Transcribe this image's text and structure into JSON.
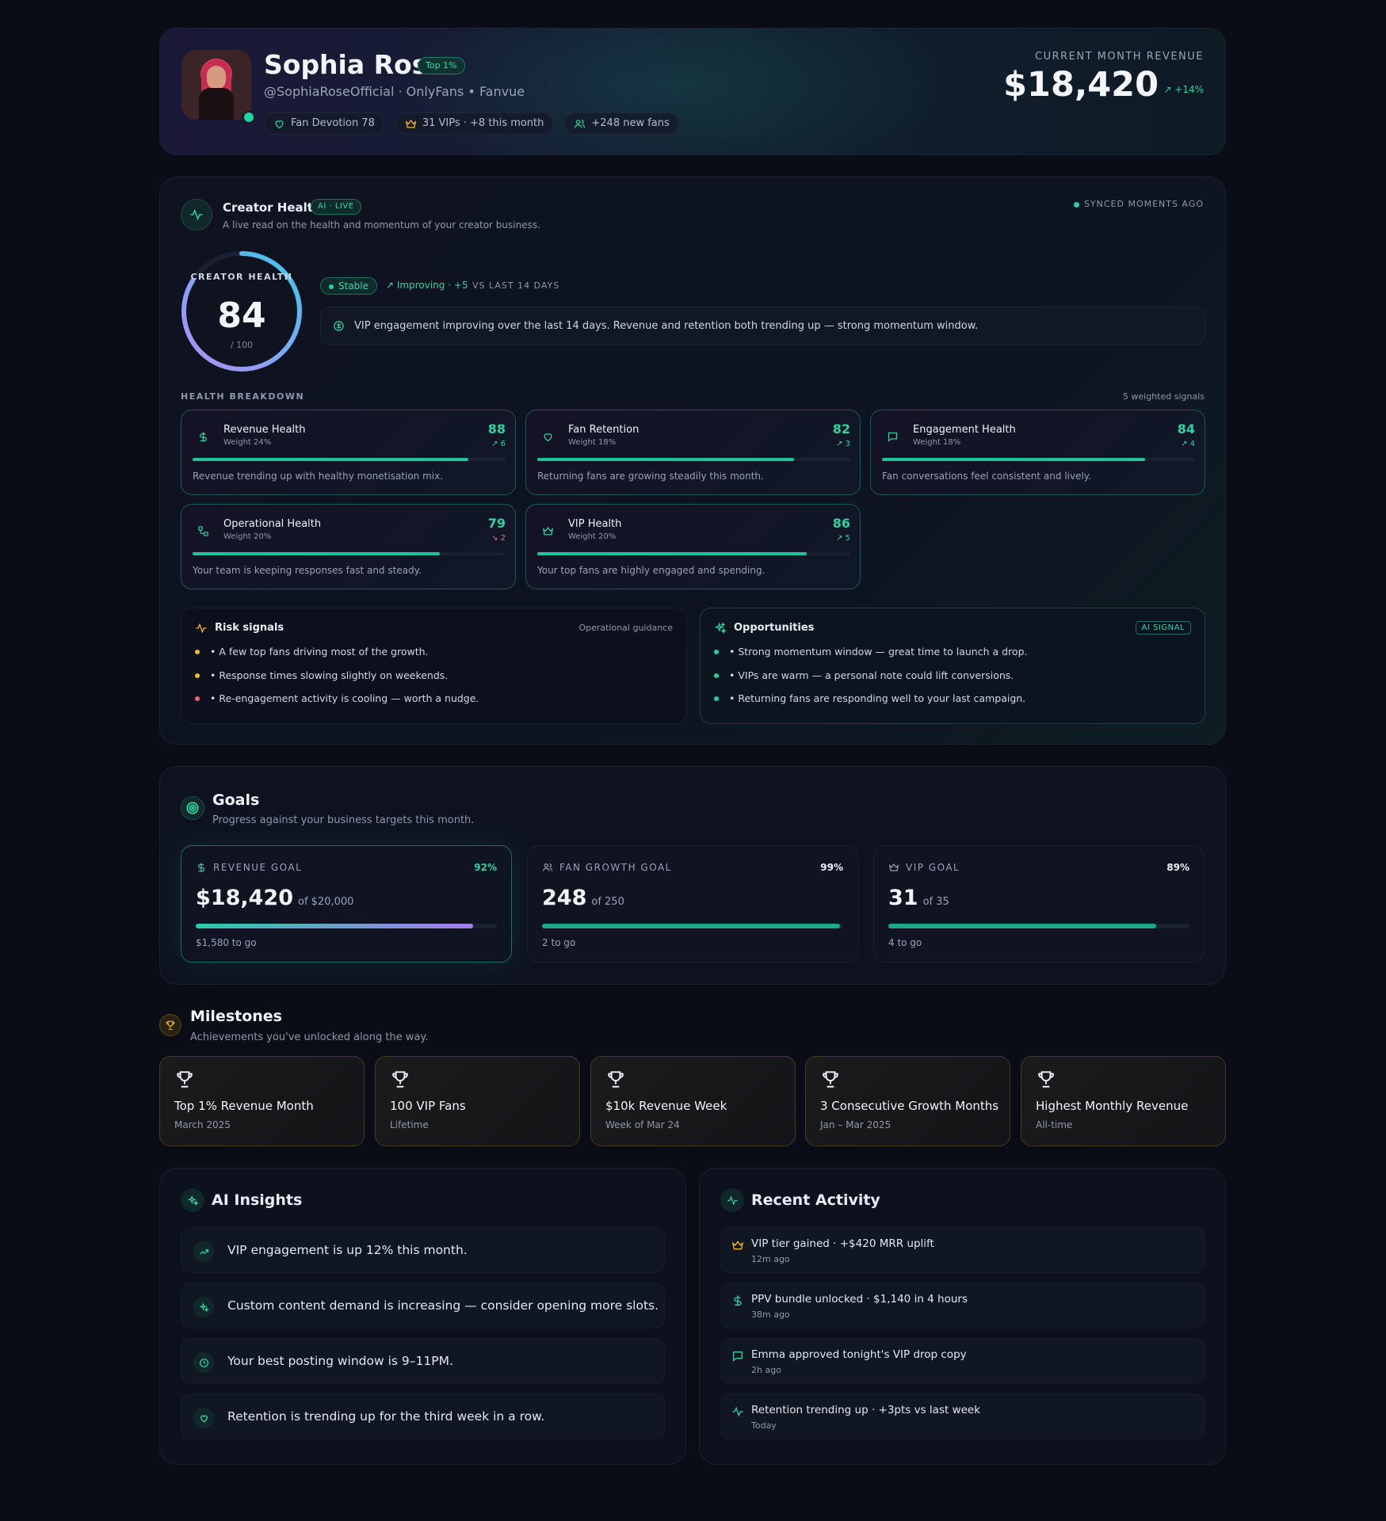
{
  "profile": {
    "name": "Sophia Rose",
    "badge": "Top 1%",
    "handle": "@SophiaRoseOfficial · OnlyFans • Fanvue",
    "chips": [
      {
        "icon": "heart-icon",
        "label": "Fan Devotion 78"
      },
      {
        "icon": "crown-icon",
        "label": "31 VIPs · +8 this month"
      },
      {
        "icon": "users-icon",
        "label": "+248 new fans"
      }
    ],
    "revenue_label": "CURRENT MONTH REVENUE",
    "revenue_value": "$18,420",
    "revenue_delta": "↗ +14%"
  },
  "health": {
    "title": "Creator Health",
    "ai_badge": "AI · LIVE",
    "subtitle": "A live read on the health and momentum of your creator business.",
    "synced": "SYNCED MOMENTS AGO",
    "gauge_label": "CREATOR HEALTH",
    "score": "84",
    "score_max": "/ 100",
    "score_fraction": 0.84,
    "status": "Stable",
    "trend": "↗ Improving · +5",
    "trend_period": "VS LAST 14 DAYS",
    "insight": "VIP engagement improving over the last 14 days. Revenue and retention both trending up — strong momentum window.",
    "breakdown_label": "HEALTH BREAKDOWN",
    "breakdown_count": "5 weighted signals",
    "cards": [
      {
        "icon": "dollar-icon",
        "title": "Revenue Health",
        "weight": "Weight 24%",
        "score": "88",
        "delta": "↗ 6",
        "fill": 0.88,
        "desc": "Revenue trending up with healthy monetisation mix."
      },
      {
        "icon": "heart-icon",
        "title": "Fan Retention",
        "weight": "Weight 18%",
        "score": "82",
        "delta": "↗ 3",
        "fill": 0.82,
        "desc": "Returning fans are growing steadily this month."
      },
      {
        "icon": "chat-icon",
        "title": "Engagement Health",
        "weight": "Weight 18%",
        "score": "84",
        "delta": "↗ 4",
        "fill": 0.84,
        "desc": "Fan conversations feel consistent and lively."
      },
      {
        "icon": "workflow-icon",
        "title": "Operational Health",
        "weight": "Weight 20%",
        "score": "79",
        "delta": "↘ 2",
        "fill": 0.79,
        "desc": "Your team is keeping responses fast and steady."
      },
      {
        "icon": "crown-icon",
        "title": "VIP Health",
        "weight": "Weight 20%",
        "score": "86",
        "delta": "↗ 5",
        "fill": 0.86,
        "desc": "Your top fans are highly engaged and spending."
      }
    ],
    "risk": {
      "title": "Risk signals",
      "right": "Operational guidance",
      "items": [
        {
          "text": "• A few top fans driving most of the growth.",
          "color": "#f5b82e"
        },
        {
          "text": "• Response times slowing slightly on weekends.",
          "color": "#f5b82e"
        },
        {
          "text": "• Re-engagement activity is cooling — worth a nudge.",
          "color": "#f0607a"
        }
      ]
    },
    "opps": {
      "title": "Opportunities",
      "badge": "AI SIGNAL",
      "items": [
        {
          "text": "• Strong momentum window — great time to launch a drop.",
          "color": "#22d3a0"
        },
        {
          "text": "• VIPs are warm — a personal note could lift conversions.",
          "color": "#22d3a0"
        },
        {
          "text": "• Returning fans are responding well to your last campaign.",
          "color": "#22d3a0"
        }
      ]
    }
  },
  "goals": {
    "title": "Goals",
    "subtitle": "Progress against your business targets this month.",
    "items": [
      {
        "icon": "dollar-icon",
        "label": "REVENUE GOAL",
        "pct": "92%",
        "value": "$18,420",
        "of": "of $20,000",
        "togo": "$1,580 to go",
        "fill": 0.92
      },
      {
        "icon": "users-icon",
        "label": "FAN GROWTH GOAL",
        "pct": "99%",
        "value": "248",
        "of": "of 250",
        "togo": "2 to go",
        "fill": 0.99
      },
      {
        "icon": "crown-icon",
        "label": "VIP GOAL",
        "pct": "89%",
        "value": "31",
        "of": "of 35",
        "togo": "4 to go",
        "fill": 0.89
      }
    ]
  },
  "milestones": {
    "title": "Milestones",
    "subtitle": "Achievements you've unlocked along the way.",
    "items": [
      {
        "title": "Top 1% Revenue Month",
        "sub": "March 2025"
      },
      {
        "title": "100 VIP Fans",
        "sub": "Lifetime"
      },
      {
        "title": "$10k Revenue Week",
        "sub": "Week of Mar 24"
      },
      {
        "title": "3 Consecutive Growth Months",
        "sub": "Jan – Mar 2025"
      },
      {
        "title": "Highest Monthly Revenue",
        "sub": "All-time"
      }
    ]
  },
  "insights": {
    "title": "AI Insights",
    "items": [
      {
        "icon": "trend-up-icon",
        "text": "VIP engagement is up 12% this month."
      },
      {
        "icon": "sparkle-icon",
        "text": "Custom content demand is increasing — consider opening more slots."
      },
      {
        "icon": "clock-icon",
        "text": "Your best posting window is 9–11PM."
      },
      {
        "icon": "heart-icon",
        "text": "Retention is trending up for the third week in a row."
      }
    ]
  },
  "activity": {
    "title": "Recent Activity",
    "items": [
      {
        "icon": "crown-icon",
        "text": "VIP tier gained · +$420 MRR uplift",
        "time": "12m ago"
      },
      {
        "icon": "dollar-icon",
        "text": "PPV bundle unlocked · $1,140 in 4 hours",
        "time": "38m ago"
      },
      {
        "icon": "chat-icon",
        "text": "Emma approved tonight's VIP drop copy",
        "time": "2h ago"
      },
      {
        "icon": "pulse-icon",
        "text": "Retention trending up · +3pts vs last week",
        "time": "Today"
      }
    ]
  },
  "colors": {
    "accent": "#2fd3a2",
    "gold": "#f5b82e",
    "danger": "#f0607a",
    "purple": "#a77bf0"
  }
}
